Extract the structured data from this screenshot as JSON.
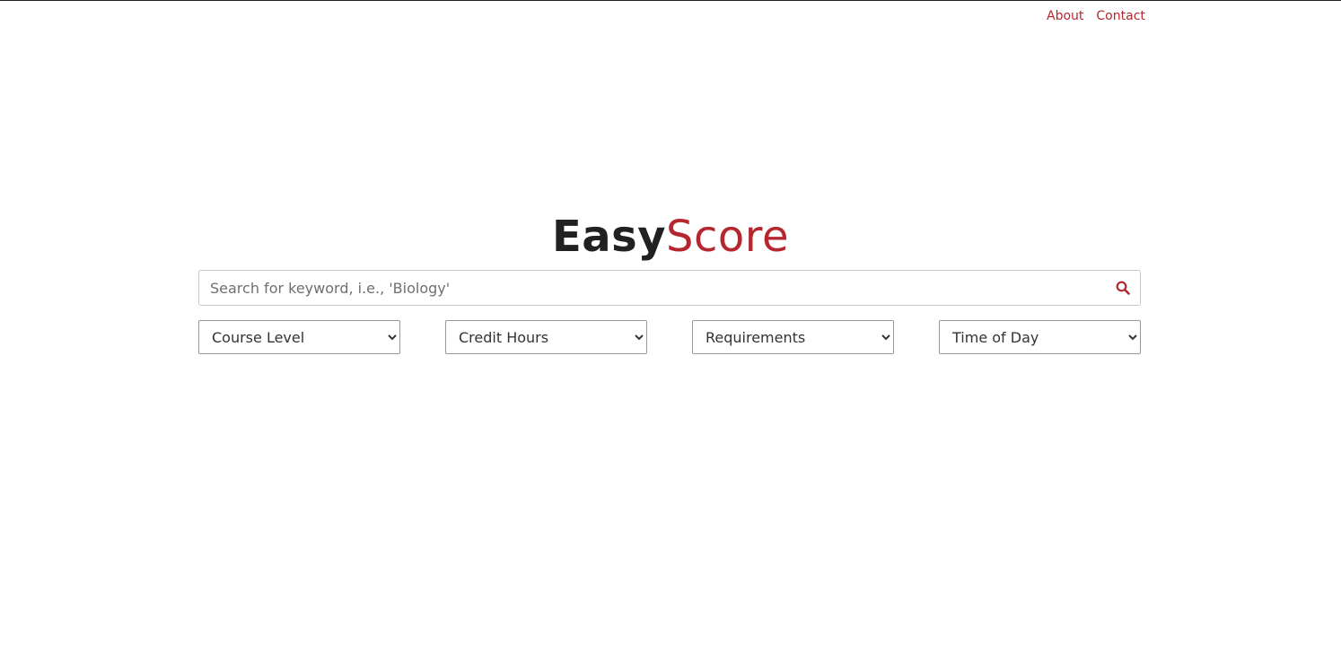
{
  "nav": {
    "about": "About",
    "contact": "Contact"
  },
  "logo": {
    "part1": "Easy",
    "part2": "Score"
  },
  "search": {
    "placeholder": "Search for keyword, i.e., 'Biology'"
  },
  "filters": {
    "course_level": "Course Level",
    "credit_hours": "Credit Hours",
    "requirements": "Requirements",
    "time_of_day": "Time of Day"
  },
  "colors": {
    "accent": "#b5262e",
    "logo_dark": "#212121"
  },
  "icons": {
    "search": "search-icon"
  }
}
